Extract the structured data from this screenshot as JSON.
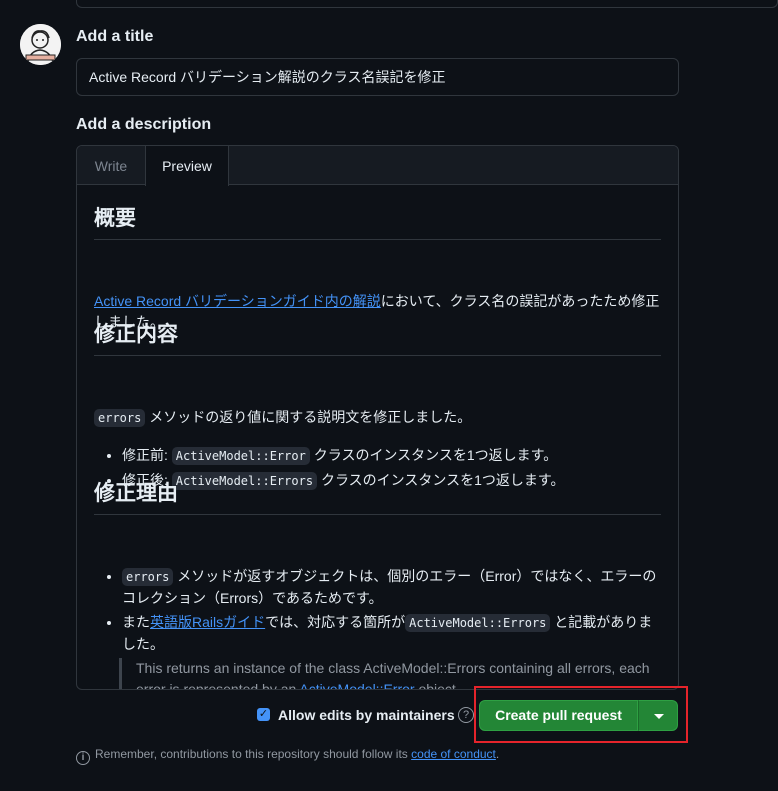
{
  "form": {
    "title_label": "Add a title",
    "title_value": "Active Record バリデーション解説のクラス名誤記を修正",
    "description_label": "Add a description"
  },
  "tabs": {
    "write": "Write",
    "preview": "Preview"
  },
  "preview": {
    "h_overview": "概要",
    "overview_link": "Active Record バリデーションガイド内の解説",
    "overview_rest": "において、クラス名の誤記があったため修正しました。",
    "h_changes": "修正内容",
    "changes_code": "errors",
    "changes_text": " メソッドの返り値に関する説明文を修正しました。",
    "before_label": "修正前: ",
    "before_code": "ActiveModel::Error",
    "before_text": " クラスのインスタンスを1つ返します。",
    "after_label": "修正後: ",
    "after_code": "ActiveModel::Errors",
    "after_text": " クラスのインスタンスを1つ返します。",
    "h_reason": "修正理由",
    "reason1_code": "errors",
    "reason1_text": " メソッドが返すオブジェクトは、個別のエラー（Error）ではなく、エラーのコレクション（Errors）であるためです。",
    "reason2_prefix": "また",
    "reason2_link": "英語版Railsガイド",
    "reason2_mid": "では、対応する箇所が",
    "reason2_code": "ActiveModel::Errors",
    "reason2_suffix": " と記載がありました。",
    "quote_text": "This returns an instance of the class ActiveModel::Errors containing all errors, each error is represented by an ",
    "quote_link": "ActiveModel::Error",
    "quote_suffix": " object."
  },
  "footer": {
    "allow_edits_label": "Allow edits by maintainers",
    "allow_edits_checked": true,
    "create_button": "Create pull request",
    "note_prefix": "Remember, contributions to this repository should follow its ",
    "note_link": "code of conduct",
    "note_suffix": "."
  },
  "colors": {
    "background": "#0d1117",
    "link": "#4493f8",
    "primary_button": "#238636",
    "highlight_box": "#e5242b"
  },
  "icons": [
    "avatar",
    "help-icon",
    "info-icon",
    "chevron-down-icon",
    "check-icon"
  ]
}
